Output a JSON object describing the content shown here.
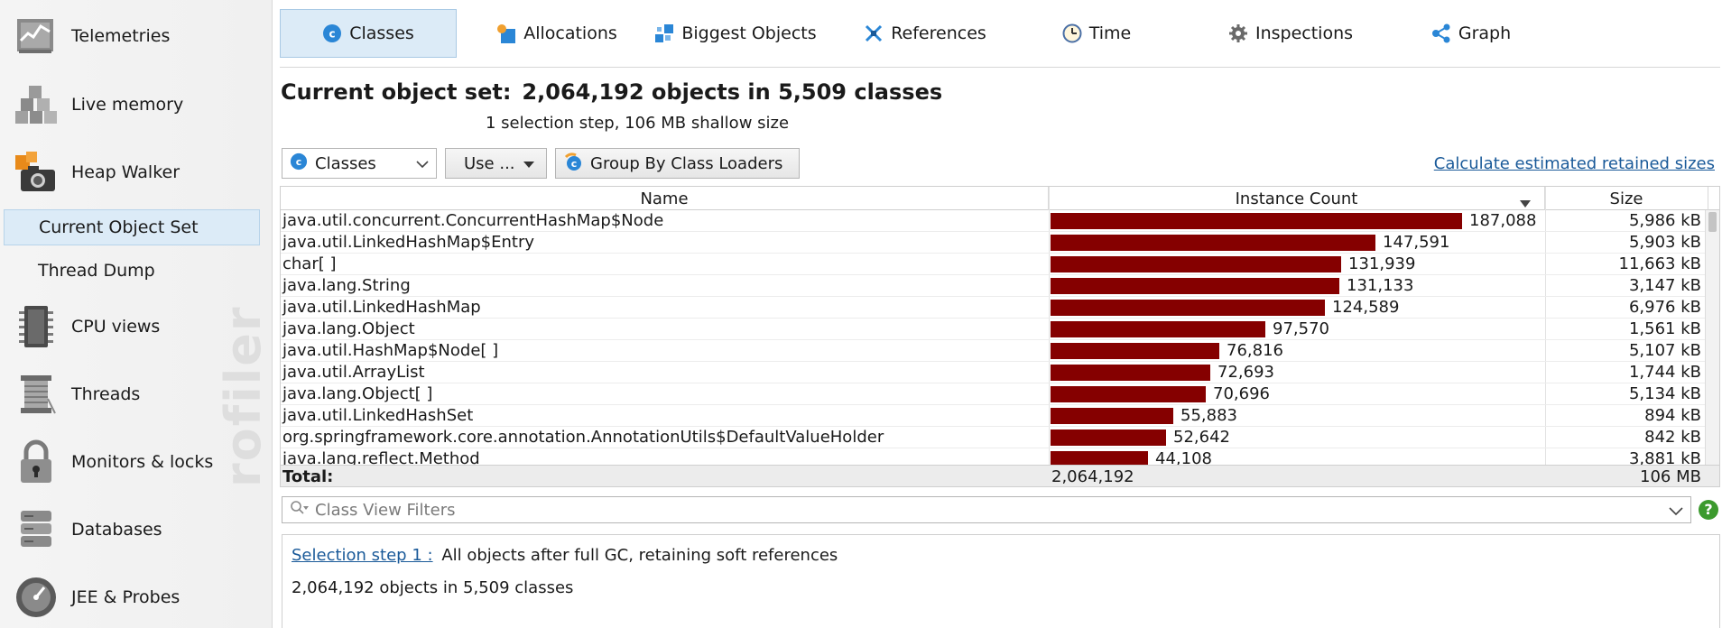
{
  "sidebar": {
    "items": [
      {
        "label": "Telemetries",
        "icon": "telemetries-icon"
      },
      {
        "label": "Live memory",
        "icon": "live-memory-icon"
      },
      {
        "label": "Heap Walker",
        "icon": "heap-walker-icon"
      },
      {
        "label": "CPU views",
        "icon": "cpu-views-icon"
      },
      {
        "label": "Threads",
        "icon": "threads-icon"
      },
      {
        "label": "Monitors & locks",
        "icon": "lock-icon"
      },
      {
        "label": "Databases",
        "icon": "database-icon"
      },
      {
        "label": "JEE & Probes",
        "icon": "gauge-icon"
      }
    ],
    "sub_items": [
      {
        "label": "Current Object Set",
        "selected": true
      },
      {
        "label": "Thread Dump",
        "selected": false
      }
    ],
    "watermark": "rofiler"
  },
  "tabs": [
    {
      "label": "Classes",
      "icon": "classes-icon",
      "active": true
    },
    {
      "label": "Allocations",
      "icon": "allocations-icon",
      "active": false
    },
    {
      "label": "Biggest Objects",
      "icon": "biggest-objects-icon",
      "active": false
    },
    {
      "label": "References",
      "icon": "references-icon",
      "active": false
    },
    {
      "label": "Time",
      "icon": "clock-icon",
      "active": false
    },
    {
      "label": "Inspections",
      "icon": "gear-icon",
      "active": false
    },
    {
      "label": "Graph",
      "icon": "graph-icon",
      "active": false
    }
  ],
  "header": {
    "title_label": "Current object set:",
    "title_count": "2,064,192 objects in 5,509 classes",
    "subtitle": "1 selection step, 106 MB shallow size"
  },
  "toolbar": {
    "view_select": "Classes",
    "use_label": "Use ...",
    "group_label": "Group By Class Loaders",
    "calc_link": "Calculate estimated retained sizes"
  },
  "table": {
    "columns": [
      "Name",
      "Instance Count",
      "Size"
    ],
    "sorted_column": "Instance Count",
    "max_count": 187088,
    "rows": [
      {
        "name": "java.util.concurrent.ConcurrentHashMap$Node",
        "count": 187088,
        "count_label": "187,088",
        "size": "5,986 kB"
      },
      {
        "name": "java.util.LinkedHashMap$Entry",
        "count": 147591,
        "count_label": "147,591",
        "size": "5,903 kB"
      },
      {
        "name": "char[ ]",
        "count": 131939,
        "count_label": "131,939",
        "size": "11,663 kB"
      },
      {
        "name": "java.lang.String",
        "count": 131133,
        "count_label": "131,133",
        "size": "3,147 kB"
      },
      {
        "name": "java.util.LinkedHashMap",
        "count": 124589,
        "count_label": "124,589",
        "size": "6,976 kB"
      },
      {
        "name": "java.lang.Object",
        "count": 97570,
        "count_label": "97,570",
        "size": "1,561 kB"
      },
      {
        "name": "java.util.HashMap$Node[ ]",
        "count": 76816,
        "count_label": "76,816",
        "size": "5,107 kB"
      },
      {
        "name": "java.util.ArrayList",
        "count": 72693,
        "count_label": "72,693",
        "size": "1,744 kB"
      },
      {
        "name": "java.lang.Object[ ]",
        "count": 70696,
        "count_label": "70,696",
        "size": "5,134 kB"
      },
      {
        "name": "java.util.LinkedHashSet",
        "count": 55883,
        "count_label": "55,883",
        "size": "894 kB"
      },
      {
        "name": "org.springframework.core.annotation.AnnotationUtils$DefaultValueHolder",
        "count": 52642,
        "count_label": "52,642",
        "size": "842 kB"
      },
      {
        "name": "java.lang.reflect.Method",
        "count": 44108,
        "count_label": "44,108",
        "size": "3,881 kB"
      }
    ],
    "total_label": "Total:",
    "total_count": "2,064,192",
    "total_size": "106 MB"
  },
  "filter": {
    "placeholder": "Class View Filters",
    "help": "?"
  },
  "details": {
    "step_link": "Selection step 1 :",
    "step_text": "All objects after full GC, retaining soft references",
    "summary": "2,064,192 objects in 5,509 classes"
  },
  "colors": {
    "bar": "#850000",
    "selection": "#dcebf7",
    "link": "#1a5a99",
    "help": "#3c9a2e"
  }
}
